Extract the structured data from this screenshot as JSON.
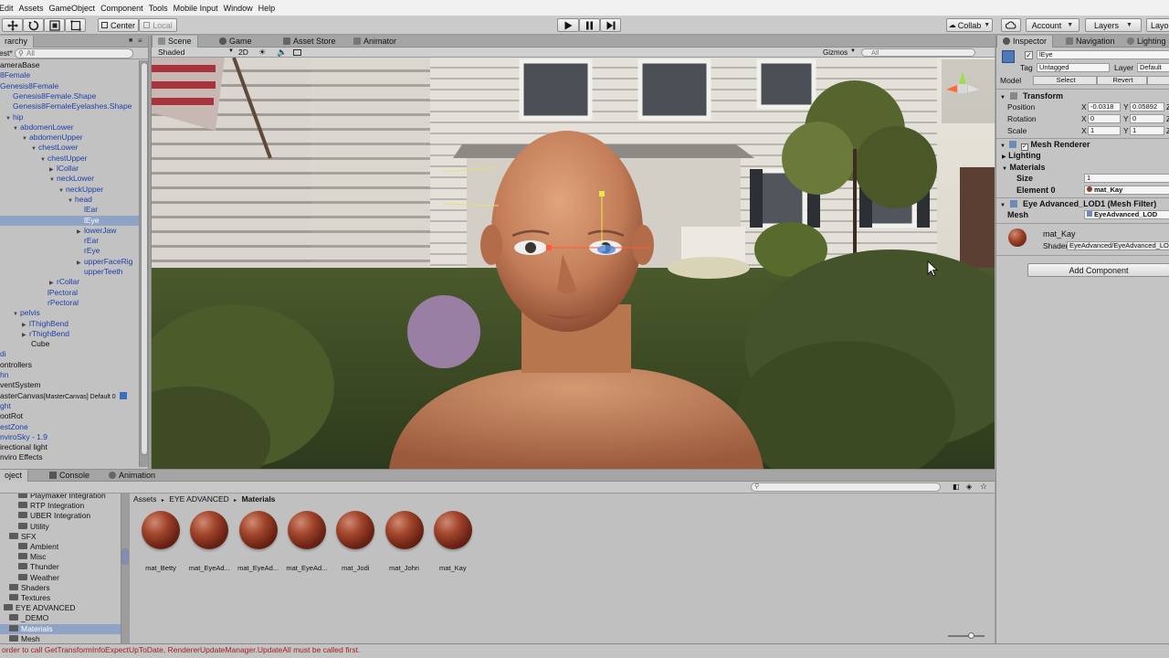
{
  "menu": [
    "Edit",
    "Assets",
    "GameObject",
    "Component",
    "Tools",
    "Mobile Input",
    "Window",
    "Help"
  ],
  "toolbar": {
    "pivot_label": "Center",
    "space_label": "Local",
    "collab_label": "Collab",
    "account_label": "Account",
    "layers_label": "Layers",
    "layout_label": "Layo"
  },
  "hierarchy": {
    "tab_label": "rarchy",
    "create_label": "est*",
    "search_placeholder": "All",
    "items": [
      {
        "label": "ameraBase",
        "indent": 0,
        "blue": false
      },
      {
        "label": "8Female",
        "indent": 0,
        "blue": true
      },
      {
        "label": "Genesis8Female",
        "indent": 0,
        "blue": true
      },
      {
        "label": "Genesis8Female.Shape",
        "indent": 14,
        "blue": true
      },
      {
        "label": "Genesis8FemaleEyelashes.Shape",
        "indent": 14,
        "blue": true
      },
      {
        "label": "hip",
        "indent": 6,
        "blue": true,
        "open": true
      },
      {
        "label": "abdomenLower",
        "indent": 14,
        "blue": true,
        "open": true
      },
      {
        "label": "abdomenUpper",
        "indent": 24,
        "blue": true,
        "open": true
      },
      {
        "label": "chestLower",
        "indent": 34,
        "blue": true,
        "open": true
      },
      {
        "label": "chestUpper",
        "indent": 44,
        "blue": true,
        "open": true
      },
      {
        "label": "lCollar",
        "indent": 54,
        "blue": true,
        "closed": true
      },
      {
        "label": "neckLower",
        "indent": 54,
        "blue": true,
        "open": true
      },
      {
        "label": "neckUpper",
        "indent": 64,
        "blue": true,
        "open": true
      },
      {
        "label": "head",
        "indent": 74,
        "blue": true,
        "open": true
      },
      {
        "label": "lEar",
        "indent": 92,
        "blue": true
      },
      {
        "label": "lEye",
        "indent": 92,
        "blue": false,
        "sel": true
      },
      {
        "label": "lowerJaw",
        "indent": 84,
        "blue": true,
        "closed": true
      },
      {
        "label": "rEar",
        "indent": 92,
        "blue": true
      },
      {
        "label": "rEye",
        "indent": 92,
        "blue": true
      },
      {
        "label": "upperFaceRig",
        "indent": 84,
        "blue": true,
        "closed": true
      },
      {
        "label": "upperTeeth",
        "indent": 92,
        "blue": true
      },
      {
        "label": "rCollar",
        "indent": 54,
        "blue": true,
        "closed": true
      },
      {
        "label": "lPectoral",
        "indent": 52,
        "blue": true
      },
      {
        "label": "rPectoral",
        "indent": 52,
        "blue": true
      },
      {
        "label": "pelvis",
        "indent": 14,
        "blue": true,
        "open": true
      },
      {
        "label": "lThighBend",
        "indent": 24,
        "blue": true,
        "closed": true
      },
      {
        "label": "rThighBend",
        "indent": 24,
        "blue": true,
        "closed": true
      },
      {
        "label": "Cube",
        "indent": 34,
        "blue": false
      },
      {
        "label": "di",
        "indent": 0,
        "blue": true
      },
      {
        "label": "ontrollers",
        "indent": 0,
        "blue": false
      },
      {
        "label": "hn",
        "indent": 0,
        "blue": true
      },
      {
        "label": "ventSystem",
        "indent": 0,
        "blue": false
      },
      {
        "label": "asterCanvas",
        "suffix": "[MasterCanvas] Default 0",
        "indent": 0,
        "blue": false
      },
      {
        "label": "ght",
        "indent": 0,
        "blue": true
      },
      {
        "label": "ootRot",
        "indent": 0,
        "blue": false
      },
      {
        "label": "estZone",
        "indent": 0,
        "blue": true
      },
      {
        "label": "nviroSky - 1.9",
        "indent": 0,
        "blue": true
      },
      {
        "label": "irectional light",
        "indent": 0,
        "blue": false
      },
      {
        "label": "nviro Effects",
        "indent": 0,
        "blue": false
      }
    ]
  },
  "scene_tabs": [
    {
      "label": "Scene",
      "active": true
    },
    {
      "label": "Game",
      "active": false
    },
    {
      "label": "Asset Store",
      "active": false
    },
    {
      "label": "Animator",
      "active": false
    }
  ],
  "scene_bar": {
    "shading_mode": "Shaded",
    "mode_2d": "2D",
    "gizmos_label": "Gizmos",
    "search_placeholder": "All"
  },
  "inspector": {
    "tabs": [
      "Inspector",
      "Navigation",
      "Lighting"
    ],
    "object_name": "lEye",
    "tag_label": "Tag",
    "tag_value": "Untagged",
    "layer_label": "Layer",
    "layer_value": "Default",
    "model_label": "Model",
    "model_select": "Select",
    "model_revert": "Revert",
    "transform_title": "Transform",
    "position_label": "Position",
    "rotation_label": "Rotation",
    "scale_label": "Scale",
    "position": {
      "x": "-0.0318",
      "y": "0.05892"
    },
    "rotation": {
      "x": "0",
      "y": "0"
    },
    "scale": {
      "x": "1",
      "y": "1"
    },
    "axis_x": "X",
    "axis_y": "Y",
    "axis_z": "Z",
    "mesh_renderer_title": "Mesh Renderer",
    "lighting_title": "Lighting",
    "materials_title": "Materials",
    "size_label": "Size",
    "size_value": "1",
    "element0_label": "Element 0",
    "element0_value": "mat_Kay",
    "mesh_filter_title": "Eye Advanced_LOD1 (Mesh Filter)",
    "mesh_label": "Mesh",
    "mesh_value": "EyeAdvanced_LOD",
    "material_name": "mat_Kay",
    "shader_label": "Shader",
    "shader_value": "EyeAdvanced/EyeAdvanced_LO",
    "add_component": "Add Component"
  },
  "project": {
    "tabs": [
      {
        "label": "oject",
        "active": true
      },
      {
        "label": "Console",
        "active": false
      },
      {
        "label": "Animation",
        "active": false
      }
    ],
    "tree": [
      {
        "label": "Playmaker Integration",
        "indent": 16
      },
      {
        "label": "RTP Integration",
        "indent": 16
      },
      {
        "label": "UBER Integration",
        "indent": 16
      },
      {
        "label": "Utility",
        "indent": 16
      },
      {
        "label": "SFX",
        "indent": 6,
        "open": true
      },
      {
        "label": "Ambient",
        "indent": 16
      },
      {
        "label": "Misc",
        "indent": 16
      },
      {
        "label": "Thunder",
        "indent": 16
      },
      {
        "label": "Weather",
        "indent": 16
      },
      {
        "label": "Shaders",
        "indent": 6
      },
      {
        "label": "Textures",
        "indent": 6
      },
      {
        "label": "EYE ADVANCED",
        "indent": 0,
        "open": true
      },
      {
        "label": "_DEMO",
        "indent": 6
      },
      {
        "label": "Materials",
        "indent": 6,
        "sel": true
      },
      {
        "label": "Mesh",
        "indent": 6
      }
    ],
    "breadcrumb": [
      "Assets",
      "EYE ADVANCED",
      "Materials"
    ],
    "assets": [
      "mat_Betty",
      "mat_EyeAd...",
      "mat_EyeAd...",
      "mat_EyeAd...",
      "mat_Jodi",
      "mat_John",
      "mat_Kay"
    ]
  },
  "status": {
    "message": "order to call GetTransformInfoExpectUpToDate, RendererUpdateManager.UpdateAll must be called first."
  }
}
